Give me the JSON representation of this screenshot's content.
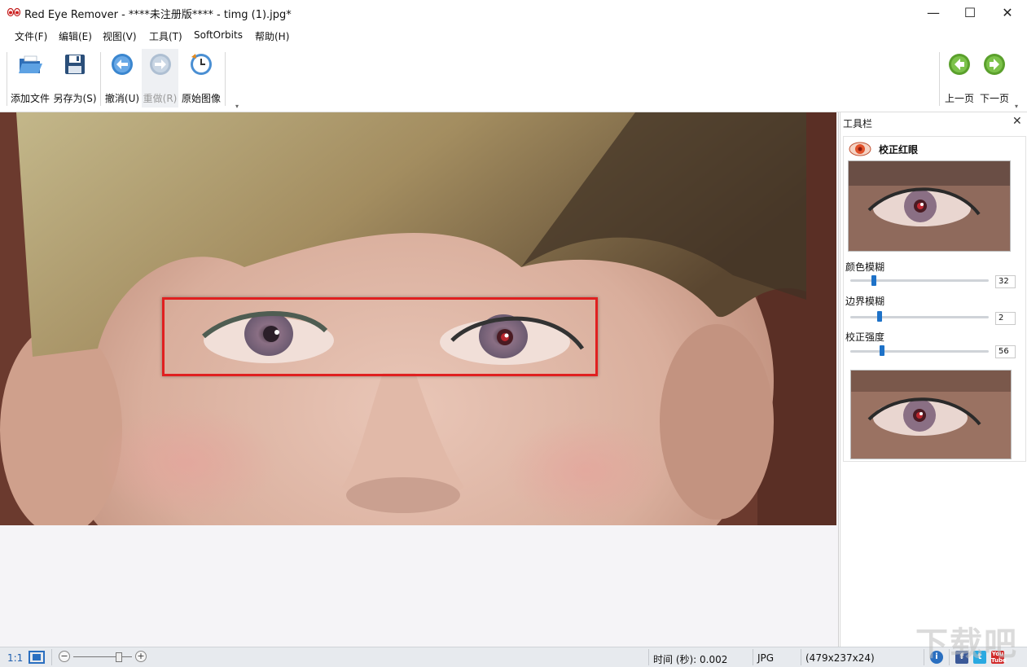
{
  "window": {
    "title": "Red Eye Remover - ****未注册版**** - timg (1).jpg*",
    "controls": {
      "minimize": "—",
      "maximize": "☐",
      "close": "✕"
    }
  },
  "menu": [
    "文件(F)",
    "编辑(E)",
    "视图(V)",
    "工具(T)",
    "SoftOrbits",
    "帮助(H)"
  ],
  "toolbar": {
    "add_file": "添加文件",
    "save_as": "另存为(S)",
    "undo": "撤消(U)",
    "redo": "重做(R)",
    "original": "原始图像",
    "prev_page": "上一页",
    "next_page": "下一页",
    "overflow": "▾"
  },
  "panel": {
    "title": "工具栏",
    "close": "✕",
    "section_title": "校正红眼",
    "sliders": [
      {
        "label": "颜色模糊",
        "value": "32",
        "level": 0.32
      },
      {
        "label": "边界模糊",
        "value": "2",
        "level": 0.2
      },
      {
        "label": "校正强度",
        "value": "56",
        "level": 0.24
      }
    ]
  },
  "status": {
    "scale": "1:1",
    "time": "时间 (秒): 0.002",
    "format": "JPG",
    "dimensions": "(479x237x24)",
    "zoom_minus": "−",
    "zoom_plus": "+",
    "zoom_level": 0.85
  },
  "icons": {
    "app": "red-eyes-icon",
    "add_file": "open-folder-icon",
    "save_as": "floppy-disk-icon",
    "undo": "undo-arrow-icon",
    "redo": "redo-arrow-icon",
    "original": "clock-icon",
    "prev_page": "green-left-arrow-icon",
    "next_page": "green-right-arrow-icon",
    "section": "red-eye-icon"
  },
  "colors": {
    "selection": "#e02020",
    "slider_thumb": "#1e72c8",
    "nav_green": "#5aa02c",
    "toolbar_blue": "#3a86cf"
  },
  "watermark": "下载吧"
}
